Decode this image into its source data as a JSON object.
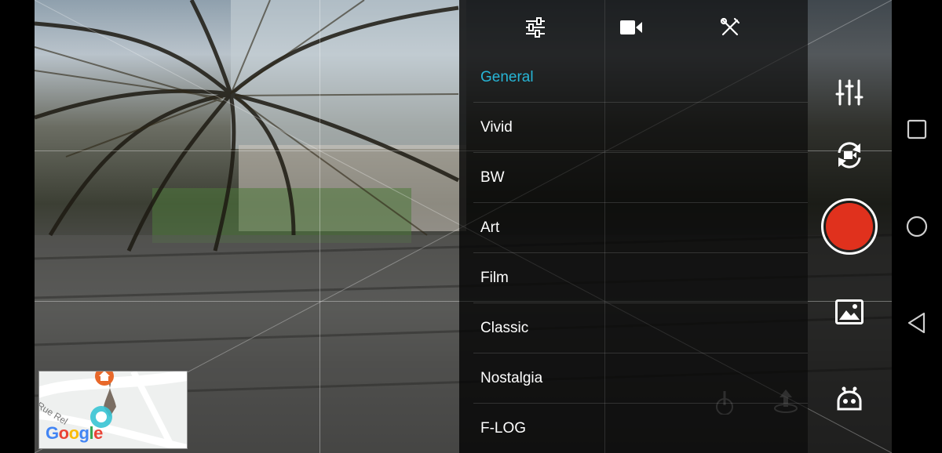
{
  "header_tabs": [
    {
      "icon": "settings-sliders-icon"
    },
    {
      "icon": "video-camera-icon"
    },
    {
      "icon": "tools-icon"
    }
  ],
  "menu": {
    "items": [
      {
        "label": "General",
        "active": true
      },
      {
        "label": "Vivid",
        "active": false
      },
      {
        "label": "BW",
        "active": false
      },
      {
        "label": "Art",
        "active": false
      },
      {
        "label": "Film",
        "active": false
      },
      {
        "label": "Classic",
        "active": false
      },
      {
        "label": "Nostalgia",
        "active": false
      },
      {
        "label": "F-LOG",
        "active": false
      }
    ],
    "active_color": "#27b5d6"
  },
  "map": {
    "street_label": "Rue Rel",
    "logo_text": "Google"
  },
  "controls": {
    "record_color": "#e0311d",
    "icons": [
      "adjust-sliders-icon",
      "switch-camera-icon",
      "record-button",
      "gallery-icon",
      "robot-mode-icon"
    ]
  },
  "navbar": {
    "icons": [
      "recents-square-icon",
      "home-circle-icon",
      "back-triangle-icon"
    ]
  }
}
